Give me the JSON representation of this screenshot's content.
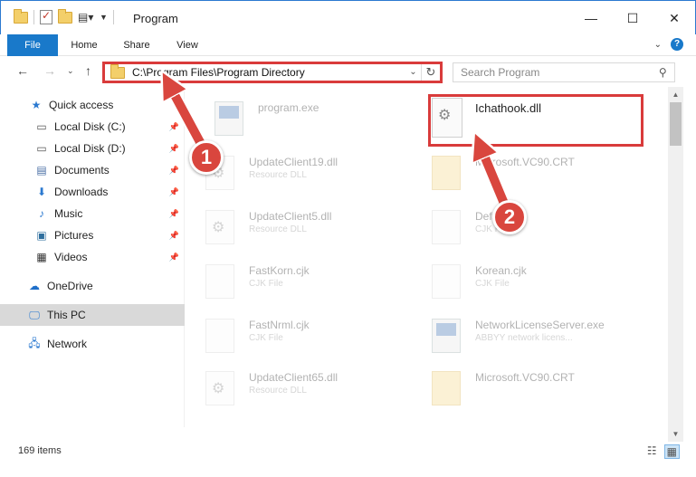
{
  "window": {
    "title": "Program",
    "buttons": {
      "minimize": "—",
      "maximize": "☐",
      "close": "✕"
    }
  },
  "ribbon": {
    "tabs": [
      "File",
      "Home",
      "Share",
      "View"
    ]
  },
  "address": {
    "path": "C:\\Program Files\\Program Directory",
    "search_placeholder": "Search Program"
  },
  "sidebar": {
    "items": [
      {
        "label": "Quick access",
        "icon": "star-icon",
        "pinned": false
      },
      {
        "label": "Local Disk (C:)",
        "icon": "drive-icon",
        "pinned": true
      },
      {
        "label": "Local Disk (D:)",
        "icon": "drive-icon",
        "pinned": true
      },
      {
        "label": "Documents",
        "icon": "documents-icon",
        "pinned": true
      },
      {
        "label": "Downloads",
        "icon": "download-icon",
        "pinned": true
      },
      {
        "label": "Music",
        "icon": "music-icon",
        "pinned": true
      },
      {
        "label": "Pictures",
        "icon": "pictures-icon",
        "pinned": true
      },
      {
        "label": "Videos",
        "icon": "videos-icon",
        "pinned": true
      },
      {
        "label": "OneDrive",
        "icon": "cloud-icon",
        "pinned": false
      },
      {
        "label": "This PC",
        "icon": "computer-icon",
        "pinned": false,
        "selected": true
      },
      {
        "label": "Network",
        "icon": "network-icon",
        "pinned": false
      }
    ]
  },
  "files": [
    {
      "name": "program.exe",
      "type": "",
      "icon": "app-icon"
    },
    {
      "name": "Ichathook.dll",
      "type": "",
      "icon": "gear-file-icon"
    },
    {
      "name": "UpdateClient19.dll",
      "type": "Resource DLL",
      "icon": "gear-file-icon"
    },
    {
      "name": "Microsoft.VC90.CRT",
      "type": "",
      "icon": "folder-icon"
    },
    {
      "name": "UpdateClient5.dll",
      "type": "Resource DLL",
      "icon": "gear-file-icon"
    },
    {
      "name": "Default.cjk",
      "type": "CJK File",
      "icon": "file-icon"
    },
    {
      "name": "FastKorn.cjk",
      "type": "CJK File",
      "icon": "file-icon"
    },
    {
      "name": "Korean.cjk",
      "type": "CJK File",
      "icon": "file-icon"
    },
    {
      "name": "FastNrml.cjk",
      "type": "CJK File",
      "icon": "file-icon"
    },
    {
      "name": "NetworkLicenseServer.exe",
      "type": "ABBYY network licens...",
      "icon": "app-icon"
    },
    {
      "name": "UpdateClient65.dll",
      "type": "Resource DLL",
      "icon": "gear-file-icon"
    },
    {
      "name": "Microsoft.VC90.CRT",
      "type": "",
      "icon": "folder-icon"
    }
  ],
  "status": {
    "item_count": "169 items"
  },
  "annotations": {
    "badge1": "1",
    "badge2": "2",
    "color": "#d9463e"
  }
}
